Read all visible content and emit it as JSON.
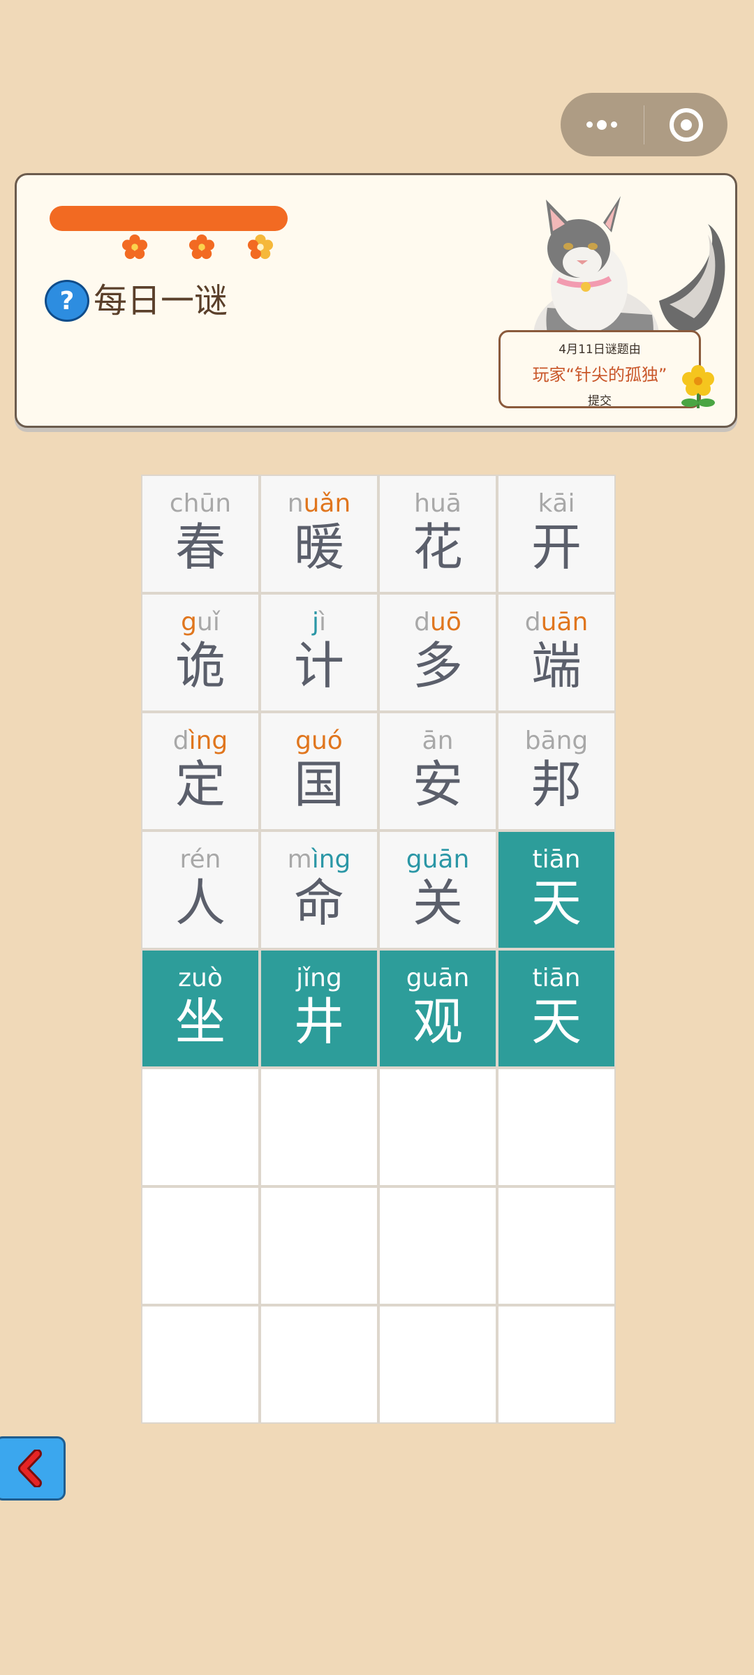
{
  "header": {
    "title": "每日一谜",
    "help_icon": "?"
  },
  "credit": {
    "line1": "4月11日谜题由",
    "line2": "玩家“针尖的孤独”",
    "line3": "提交"
  },
  "colors": {
    "background": "#f0d9b8",
    "accent": "#f26a22",
    "solved": "#2d9d9a",
    "pinyin_orange": "#e0761e",
    "pinyin_teal": "#2b97a6"
  },
  "grid": {
    "rows": [
      [
        {
          "py": [
            [
              "ch",
              "g"
            ],
            [
              "ū",
              "g"
            ],
            [
              "n",
              "g"
            ]
          ],
          "tone_color": "o",
          "hz": "春",
          "state": "normal"
        },
        {
          "py": [
            [
              "n",
              "g"
            ],
            [
              "uǎn",
              "o"
            ]
          ],
          "tone_color": "t",
          "hz": "暖",
          "state": "normal"
        },
        {
          "py": [
            [
              "hu",
              "g"
            ],
            [
              "ā",
              "g"
            ]
          ],
          "tone_color": "t",
          "hz": "花",
          "state": "normal"
        },
        {
          "py": [
            [
              "k",
              "g"
            ],
            [
              "āi",
              "g"
            ]
          ],
          "tone_color": "t",
          "hz": "开",
          "state": "normal"
        }
      ],
      [
        {
          "py": [
            [
              "g",
              "o"
            ],
            [
              "uǐ",
              "g"
            ]
          ],
          "tone_color": "o",
          "hz": "诡",
          "state": "normal"
        },
        {
          "py": [
            [
              "j",
              "t"
            ],
            [
              "ì",
              "g"
            ]
          ],
          "tone_color": "o",
          "hz": "计",
          "state": "normal"
        },
        {
          "py": [
            [
              "d",
              "g"
            ],
            [
              "uō",
              "o"
            ]
          ],
          "tone_color": "t",
          "hz": "多",
          "state": "normal"
        },
        {
          "py": [
            [
              "d",
              "g"
            ],
            [
              "uān",
              "o"
            ]
          ],
          "tone_color": "t",
          "hz": "端",
          "state": "normal"
        }
      ],
      [
        {
          "py": [
            [
              "d",
              "g"
            ],
            [
              "ìng",
              "o"
            ]
          ],
          "tone_color": "t",
          "hz": "定",
          "state": "normal"
        },
        {
          "py": [
            [
              "guó",
              "o"
            ]
          ],
          "tone_color": "g",
          "hz": "国",
          "state": "normal"
        },
        {
          "py": [
            [
              "ān",
              "g"
            ]
          ],
          "tone_color": "t",
          "hz": "安",
          "state": "normal"
        },
        {
          "py": [
            [
              "bāng",
              "g"
            ]
          ],
          "tone_color": "t",
          "hz": "邦",
          "state": "normal"
        }
      ],
      [
        {
          "py": [
            [
              "rén",
              "g"
            ]
          ],
          "tone_color": "g",
          "hz": "人",
          "state": "normal"
        },
        {
          "py": [
            [
              "m",
              "g"
            ],
            [
              "ìng",
              "t"
            ]
          ],
          "tone_color": "o",
          "hz": "命",
          "state": "normal"
        },
        {
          "py": [
            [
              "guān",
              "t"
            ]
          ],
          "tone_color": "t",
          "hz": "关",
          "state": "normal"
        },
        {
          "py": [
            [
              "tiān",
              "w"
            ]
          ],
          "tone_color": "w",
          "hz": "天",
          "state": "done"
        }
      ],
      [
        {
          "py": [
            [
              "zuò",
              "w"
            ]
          ],
          "tone_color": "w",
          "hz": "坐",
          "state": "done"
        },
        {
          "py": [
            [
              "jǐng",
              "w"
            ]
          ],
          "tone_color": "w",
          "hz": "井",
          "state": "done"
        },
        {
          "py": [
            [
              "guān",
              "w"
            ]
          ],
          "tone_color": "w",
          "hz": "观",
          "state": "done"
        },
        {
          "py": [
            [
              "tiān",
              "w"
            ]
          ],
          "tone_color": "w",
          "hz": "天",
          "state": "done"
        }
      ]
    ],
    "empty_rows": 3
  },
  "back_button": {
    "icon": "chevron-left-icon"
  },
  "capsule": {
    "more_icon": "more-icon",
    "close_icon": "target-icon"
  }
}
